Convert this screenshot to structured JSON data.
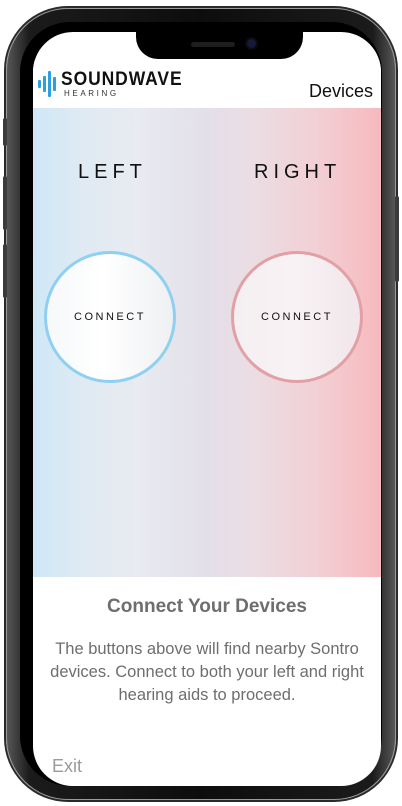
{
  "app": {
    "logo_name": "SOUNDWAVE",
    "logo_sub": "HEARING",
    "brand_color": "#2aa0e0",
    "nav_link": "Devices"
  },
  "pairing": {
    "left": {
      "label": "LEFT",
      "button_label": "CONNECT",
      "accent_color": "#8fd0f0"
    },
    "right": {
      "label": "RIGHT",
      "button_label": "CONNECT",
      "accent_color": "#e1a0a6"
    }
  },
  "info": {
    "title": "Connect Your Devices",
    "body": "The buttons above will find nearby Sontro devices. Connect to both your left and right hearing aids to proceed."
  },
  "footer": {
    "exit_label": "Exit"
  }
}
